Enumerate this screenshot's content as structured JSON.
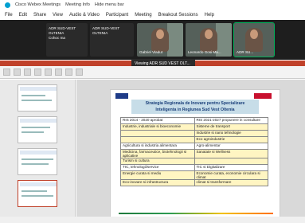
{
  "window": {
    "app_title": "Cisco Webex Meetings",
    "meeting_info": "Meeting Info",
    "hide_menu_bar": "Hide menu bar"
  },
  "menu": [
    "File",
    "Edit",
    "Share",
    "View",
    "Audio & Video",
    "Participant",
    "Meeting",
    "Breakout Sessions",
    "Help"
  ],
  "video_tiles": [
    {
      "name": "ADR SUD-VEST OLTENIA",
      "sub": "Cohoc Ina"
    },
    {
      "name": "ADR SUD-VEST OLTENIA"
    },
    {
      "name": "Gabriel Vladut"
    },
    {
      "name": "Leonardo Gosi Ma..."
    },
    {
      "name": "ADR SU..."
    }
  ],
  "viewing_banner": "Viewing ADR SUD VEST OLT...",
  "slide": {
    "title_line1": "Strategia Regionala de Inovare pentru Specializare",
    "title_line2": "Inteligenta in Regiunea Sud Vest Oltenia",
    "table_rows": [
      {
        "left": "RIS 2014 - 2020 aprobat",
        "right": "RIS 2021-2027 propunere in consultare",
        "tone": "wt"
      },
      {
        "left": "Industrie, industriale si bioeconomie",
        "right": "Sisteme de transport",
        "tone": "lt"
      },
      {
        "left": "",
        "right": "Industrie si nano tehnologie",
        "tone": "lt"
      },
      {
        "left": "",
        "right": "Eco agroindustrie",
        "tone": "lt"
      },
      {
        "left": "Agricultura si industria alimentara",
        "right": "Agro-alimentar",
        "tone": "wt"
      },
      {
        "left": "Medicina, farmaceutice, biotehnologii si aplicative",
        "right": "Sanatate si Wellness",
        "tone": "lt"
      },
      {
        "left": "Turism si cultura",
        "right": "",
        "tone": "lt"
      },
      {
        "left": "TIC, tehnologii/service",
        "right": "TIC si Digitalizare",
        "tone": "wt"
      },
      {
        "left": "Energie curata si mediu",
        "right": "Economie curata, economie circulara si climat",
        "tone": "lt"
      },
      {
        "left": "Eco-inovare si infrastructura",
        "right": "climat si transformare",
        "tone": "lt"
      }
    ]
  }
}
